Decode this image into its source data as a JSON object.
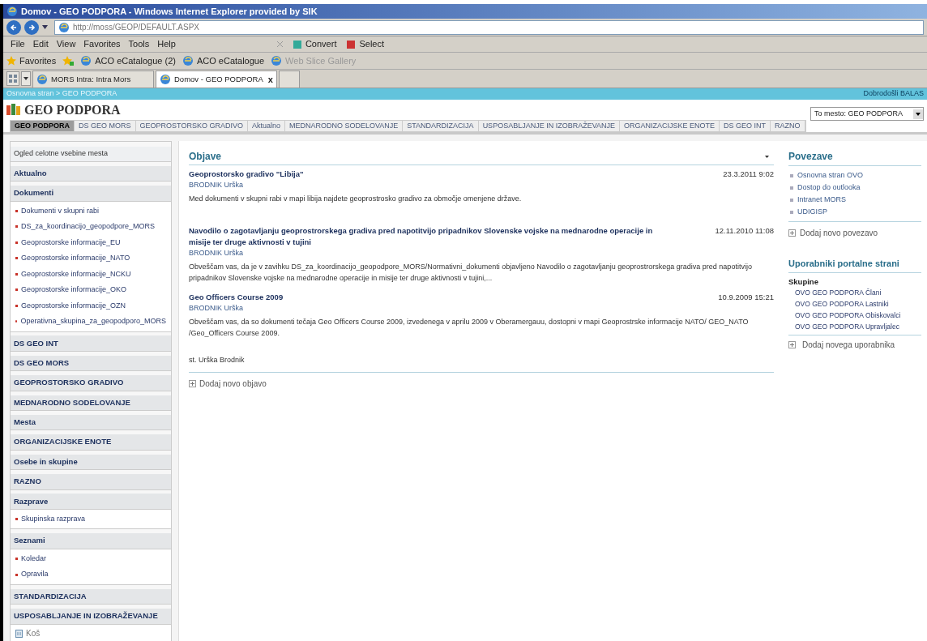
{
  "window": {
    "title": "Domov - GEO PODPORA - Windows Internet Explorer provided by SIK"
  },
  "address_bar": {
    "value": "http://moss/GEOP/DEFAULT.ASPX"
  },
  "menu_bar": {
    "items": [
      "File",
      "Edit",
      "View",
      "Favorites",
      "Tools",
      "Help"
    ],
    "tools": [
      "Convert",
      "Select"
    ]
  },
  "favorites_bar": {
    "label": "Favorites",
    "items": [
      "ACO eCatalogue (2)",
      "ACO eCatalogue",
      "Web Slice Gallery"
    ]
  },
  "browser_tabs": [
    {
      "label": "MORS Intra: Intra Mors",
      "selected": false
    },
    {
      "label": "Domov - GEO PODPORA",
      "selected": true
    }
  ],
  "close_tab": "x",
  "breadcrumb": "Osnovna stran > GEO PODPORA",
  "welcome": "Dobrodošli BALAS",
  "site_title": "GEO PODPORA",
  "scope_select": {
    "value": "To mesto: GEO PODPORA"
  },
  "nav_tabs": [
    {
      "label": "GEO PODPORA",
      "selected": true
    },
    {
      "label": "DS GEO MORS",
      "selected": false
    },
    {
      "label": "GEOPROSTORSKO GRADIVO",
      "selected": false
    },
    {
      "label": "Aktualno",
      "selected": false
    },
    {
      "label": "MEDNARODNO SODELOVANJE",
      "selected": false
    },
    {
      "label": "STANDARDIZACIJA",
      "selected": false
    },
    {
      "label": "USPOSABLJANJE IN IZOBRAŽEVANJE",
      "selected": false
    },
    {
      "label": "ORGANIZACIJSKE ENOTE",
      "selected": false
    },
    {
      "label": "DS GEO INT",
      "selected": false
    },
    {
      "label": "RAZNO",
      "selected": false
    }
  ],
  "sidebar": {
    "view_all": "Ogled celotne vsebine mesta",
    "sections": [
      {
        "title": "Aktualno"
      },
      {
        "title": "Dokumenti",
        "items": [
          "Dokumenti v skupni rabi",
          "DS_za_koordinacijo_geopodpore_MORS",
          "Geoprostorske informacije_EU",
          "Geoprostorske informacije_NATO",
          "Geoprostorske informacije_NCKU",
          "Geoprostorske informacije_OKO",
          "Geoprostorske informacije_OZN",
          "Operativna_skupina_za_geopodporo_MORS"
        ]
      },
      {
        "title": "DS GEO INT"
      },
      {
        "title": "DS GEO MORS"
      },
      {
        "title": "GEOPROSTORSKO GRADIVO"
      },
      {
        "title": "MEDNARODNO SODELOVANJE"
      },
      {
        "title": "Mesta"
      },
      {
        "title": "ORGANIZACIJSKE ENOTE"
      },
      {
        "title": "Osebe in skupine"
      },
      {
        "title": "RAZNO"
      },
      {
        "title": "Razprave",
        "items": [
          "Skupinska razprava"
        ]
      },
      {
        "title": "Seznami",
        "items": [
          "Koledar",
          "Opravila"
        ]
      },
      {
        "title": "STANDARDIZACIJA"
      },
      {
        "title": "USPOSABLJANJE IN IZOBRAŽEVANJE"
      }
    ],
    "recycle_bin": "Koš"
  },
  "announcements": {
    "title": "Objave",
    "items": [
      {
        "title": "Geoprostorsko gradivo \"Libija\"",
        "date": "23.3.2011 9:02",
        "author": "BRODNIK Urška",
        "body": "Med dokumenti v skupni rabi v mapi libija najdete geoprostrosko gradivo za območje omenjene države."
      },
      {
        "title": "Navodilo o zagotavljanju geoprostrorskega gradiva pred napotitvijo pripadnikov Slovenske vojske na mednarodne operacije in misije ter druge aktivnosti v tujini",
        "date": "12.11.2010 11:08",
        "author": "BRODNIK Urška",
        "body": "Obveščam vas, da je v zavihku DS_za_koordinacijo_geopodpore_MORS/Normativni_dokumenti objavljeno Navodilo o zagotavljanju geoprostrorskega gradiva pred napotitvijo pripadnikov Slovenske vojske na mednarodne operacije in misije ter druge aktivnosti v tujini,..."
      },
      {
        "title": "Geo Officers Course 2009",
        "date": "10.9.2009 15:21",
        "author": "BRODNIK Urška",
        "body": "Obveščam vas, da so dokumenti tečaja Geo Officers Course 2009, izvedenega v aprilu 2009 v Oberamergauu, dostopni v mapi Geoprostrske informacije NATO/ GEO_NATO /Geo_Officers Course 2009."
      }
    ],
    "signature": "st. Urška Brodnik",
    "add": "Dodaj novo objavo"
  },
  "links": {
    "title": "Povezave",
    "items": [
      "Osnovna stran OVO",
      "Dostop do outlooka",
      "Intranet MORS",
      "UDIGISP"
    ],
    "add": "Dodaj novo povezavo"
  },
  "users": {
    "title": "Uporabniki portalne strani",
    "group_label": "Skupine",
    "items": [
      "OVO GEO PODPORA Člani",
      "OVO GEO PODPORA Lastniki",
      "OVO GEO PODPORA Obiskovalci",
      "OVO GEO PODPORA Upravljalec"
    ],
    "add": "Dodaj novega uporabnika"
  }
}
